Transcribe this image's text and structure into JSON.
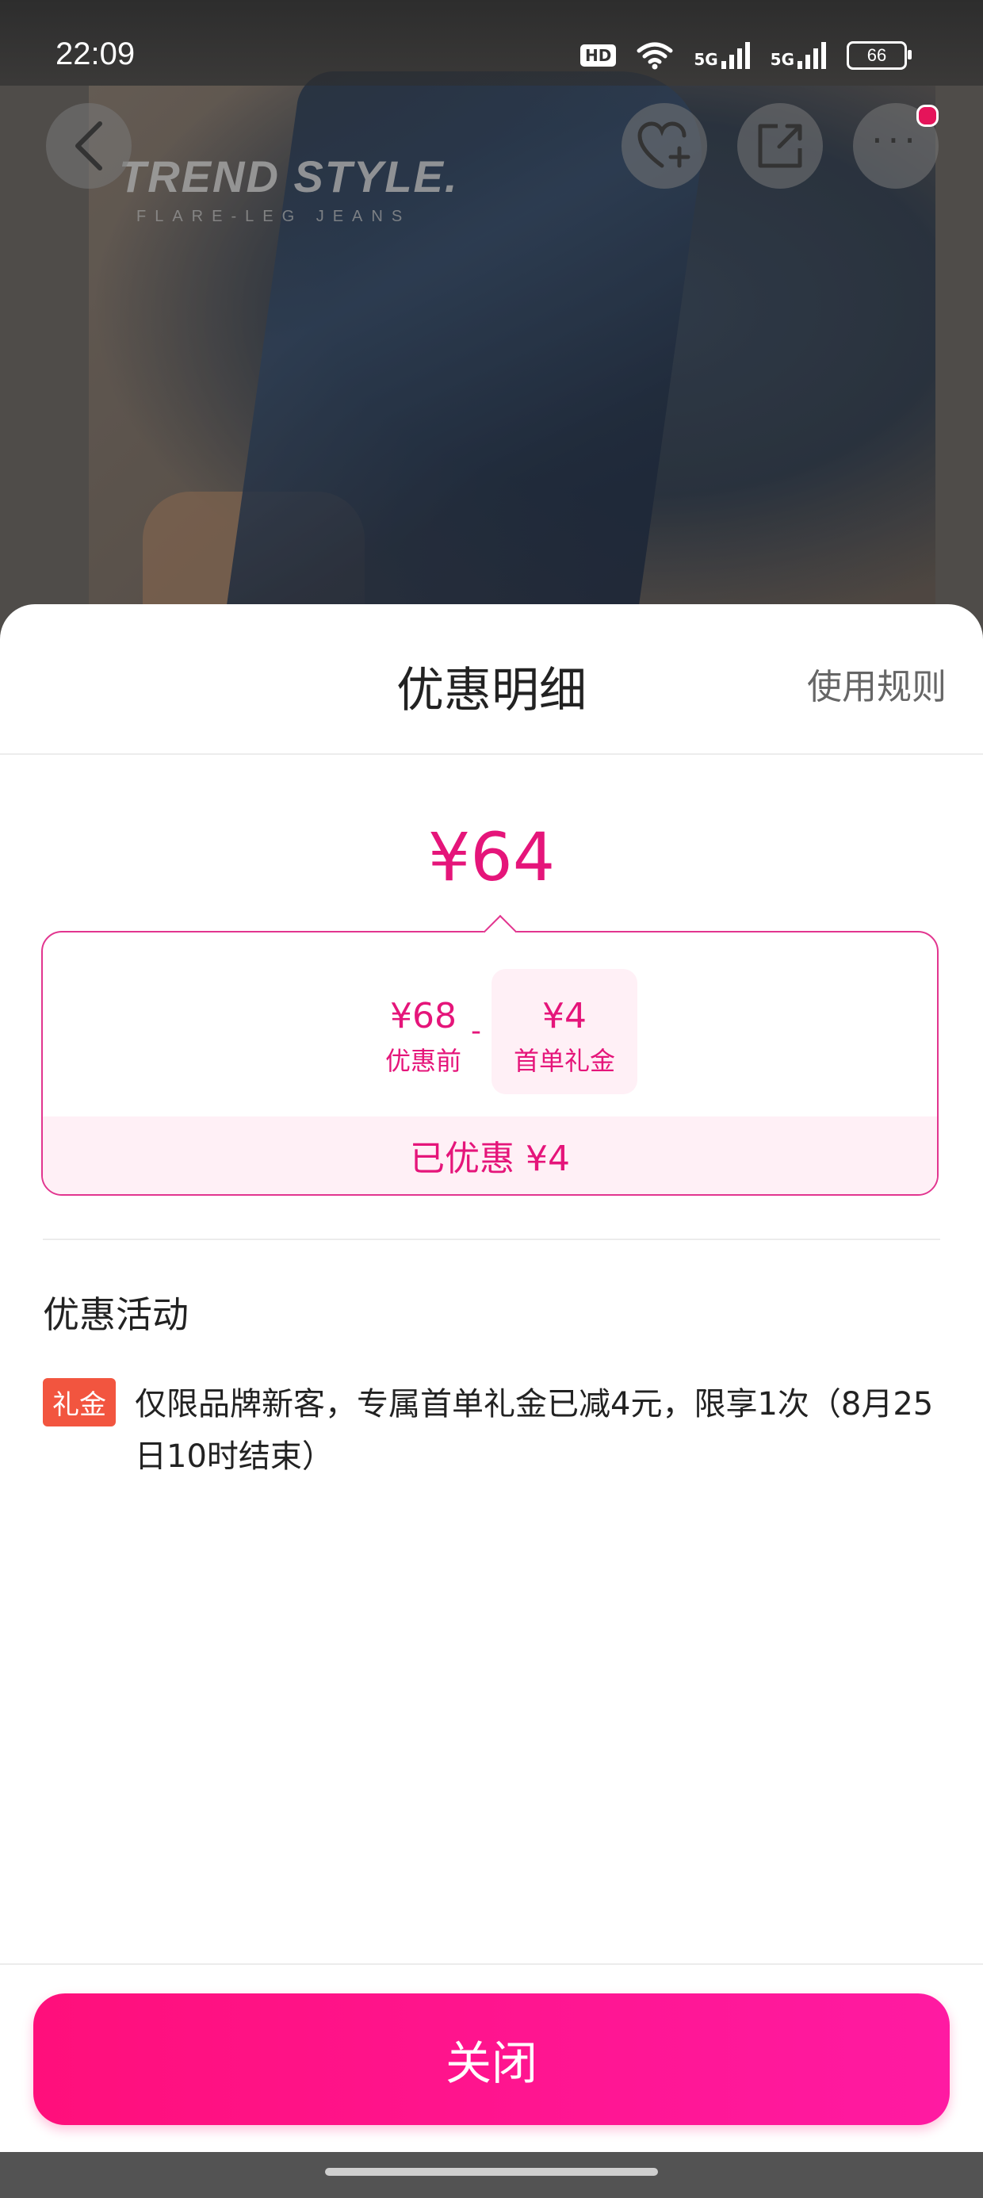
{
  "status_bar": {
    "time": "22:09",
    "hd_label": "HD",
    "signal_1_label": "5G",
    "signal_2_label": "5G",
    "battery": "66"
  },
  "background": {
    "brand_text": "TREND STYLE.",
    "brand_subtext": "FLARE-LEG JEANS"
  },
  "top_actions": {
    "back_icon": "chevron-left-icon",
    "favorite_icon": "heart-plus-icon",
    "share_icon": "share-icon",
    "more_icon": "more-icon",
    "more_label": "···"
  },
  "sheet": {
    "title": "优惠明细",
    "rules_link": "使用规则",
    "total_price": "¥64",
    "breakdown": {
      "original_amount": "¥68",
      "original_label": "优惠前",
      "minus": "-",
      "coupon_amount": "¥4",
      "coupon_label": "首单礼金",
      "saved_text": "已优惠 ¥4"
    },
    "section_title": "优惠活动",
    "promotions": [
      {
        "badge": "礼金",
        "text": "仅限品牌新客，专属首单礼金已减4元，限享1次（8月25日10时结束）"
      }
    ],
    "close_button": "关闭"
  },
  "colors": {
    "accent": "#e5157a",
    "button_start": "#ff0f7b",
    "button_end": "#ff1aa2",
    "badge": "#f2553f",
    "tint": "#fff0f6"
  }
}
